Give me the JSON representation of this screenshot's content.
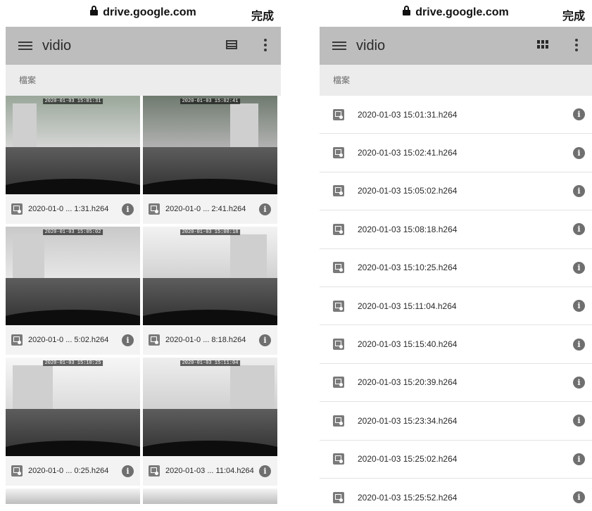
{
  "left_panel": {
    "url": "drive.google.com",
    "done_label": "完成",
    "app_title": "vidio",
    "section_label": "檔案",
    "view_toggle_icon": "list-view-icon",
    "files": [
      {
        "name": "2020-01-0 ... 1:31.h264",
        "stamp": "2020-01-03 15:01:31"
      },
      {
        "name": "2020-01-0 ... 2:41.h264",
        "stamp": "2020-01-03 15:02:41"
      },
      {
        "name": "2020-01-0 ... 5:02.h264",
        "stamp": "2020-01-03 15:05:02"
      },
      {
        "name": "2020-01-0 ... 8:18.h264",
        "stamp": "2020-01-03 15:08:18"
      },
      {
        "name": "2020-01-0 ... 0:25.h264",
        "stamp": "2020-01-03 15:10:25"
      },
      {
        "name": "2020-01-03 ... 11:04.h264",
        "stamp": "2020-01-03 15:11:04"
      }
    ]
  },
  "right_panel": {
    "url": "drive.google.com",
    "done_label": "完成",
    "app_title": "vidio",
    "section_label": "檔案",
    "view_toggle_icon": "grid-view-icon",
    "files": [
      "2020-01-03 15:01:31.h264",
      "2020-01-03 15:02:41.h264",
      "2020-01-03 15:05:02.h264",
      "2020-01-03 15:08:18.h264",
      "2020-01-03 15:10:25.h264",
      "2020-01-03 15:11:04.h264",
      "2020-01-03 15:15:40.h264",
      "2020-01-03 15:20:39.h264",
      "2020-01-03 15:23:34.h264",
      "2020-01-03 15:25:02.h264",
      "2020-01-03 15:25:52.h264"
    ]
  },
  "colors": {
    "toolbar_bg": "#bdbdbd",
    "section_bg": "#ececec",
    "info_icon": "#6f6f6f"
  }
}
